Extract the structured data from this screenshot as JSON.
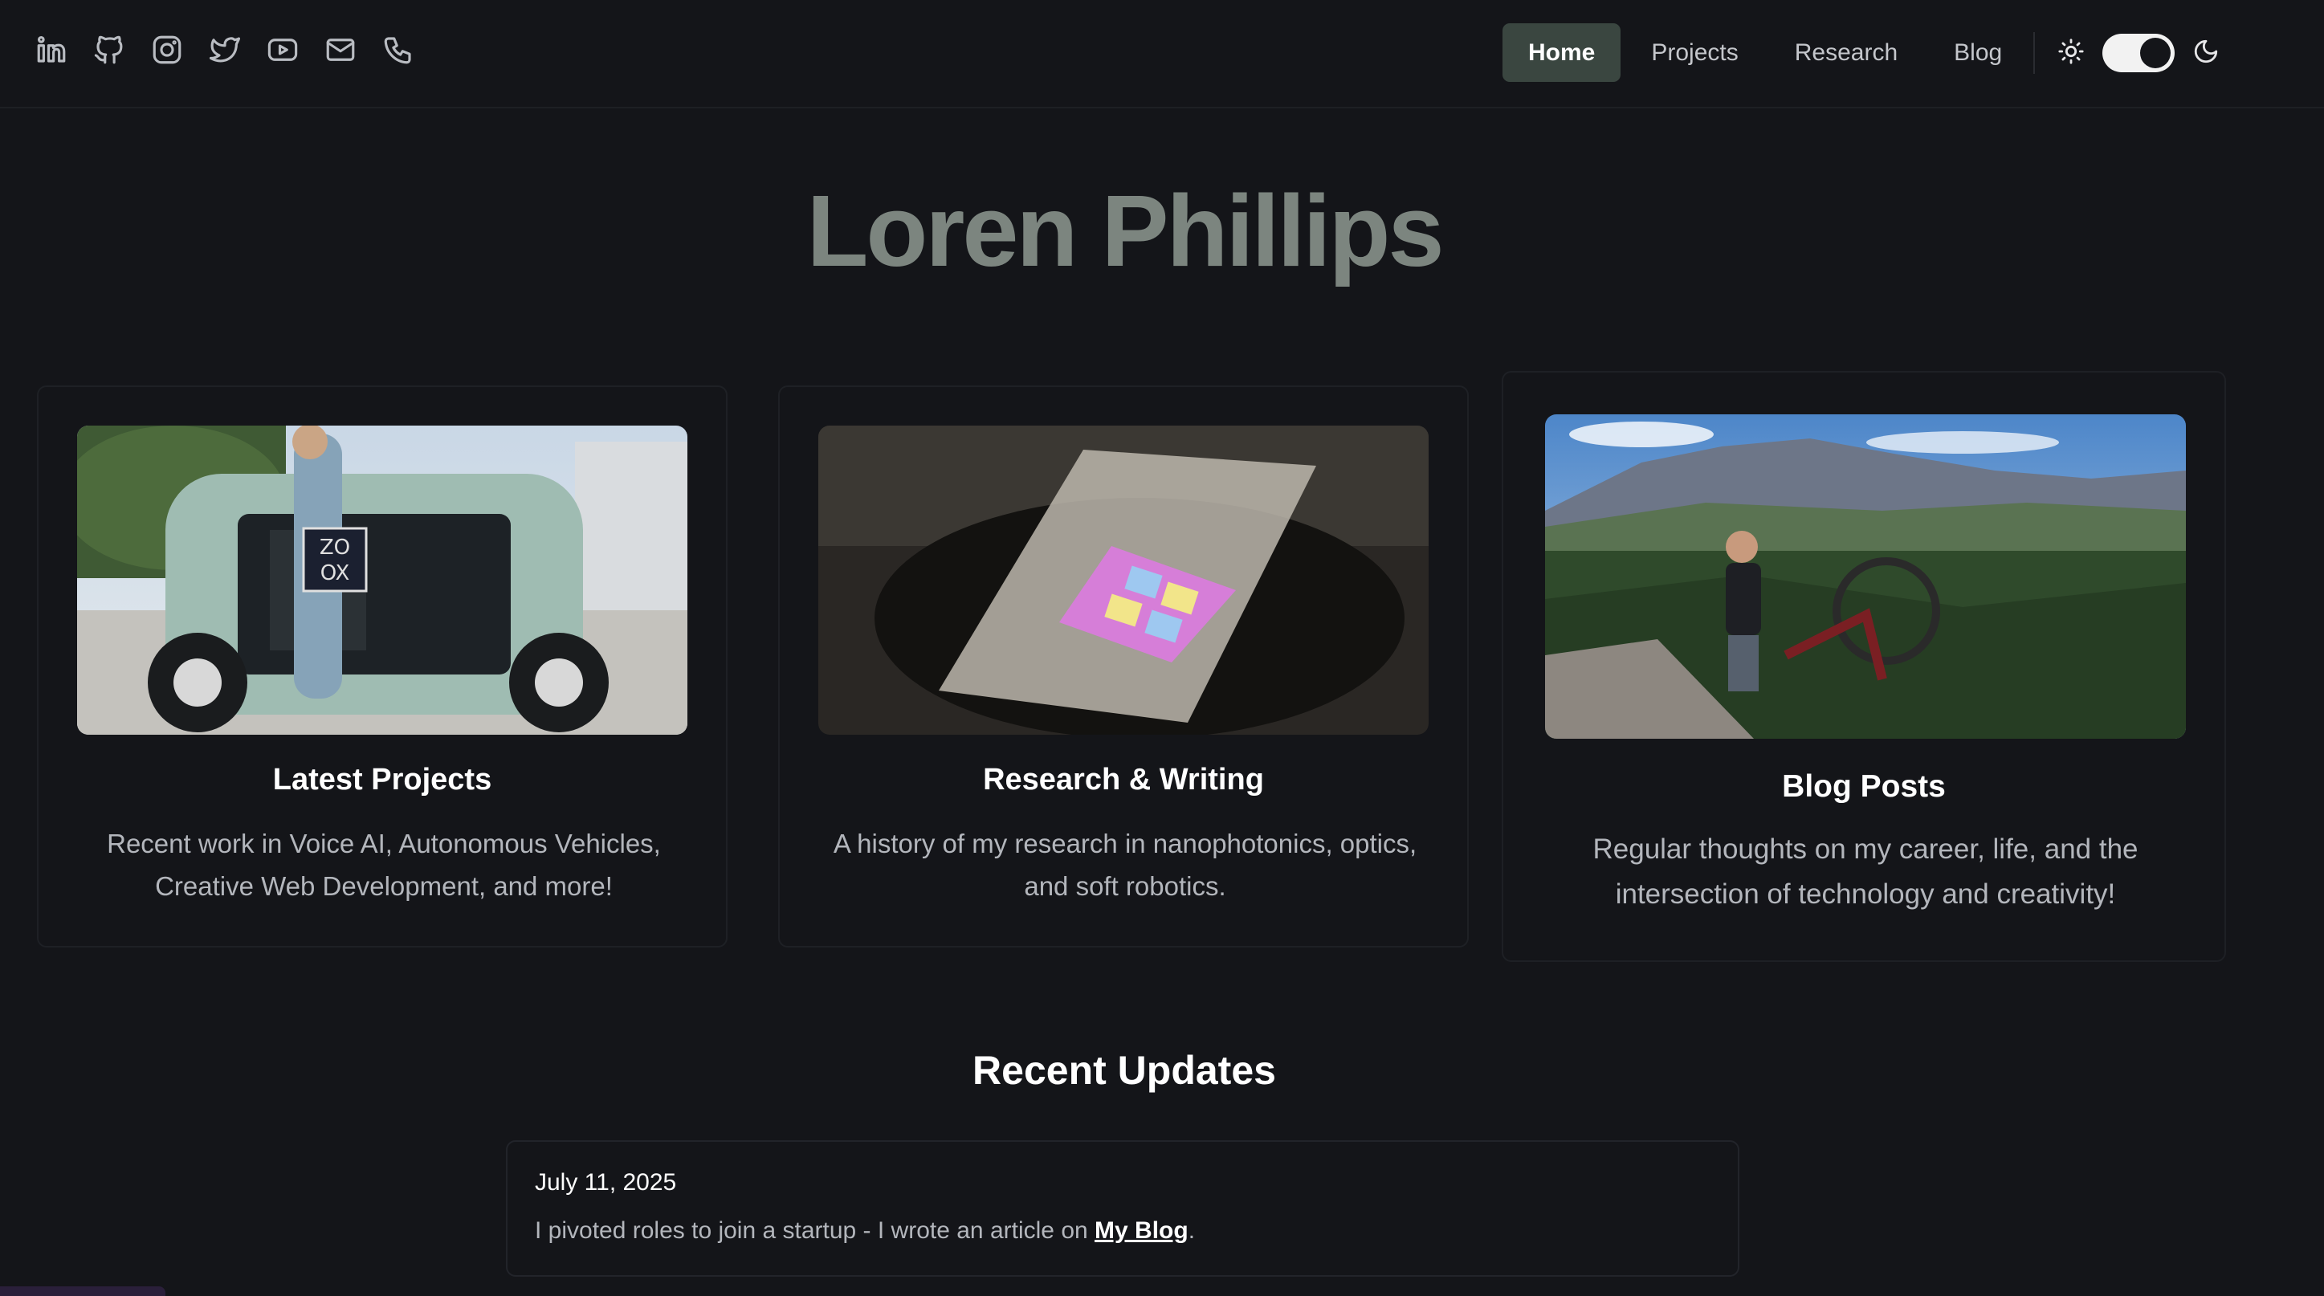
{
  "header": {
    "social_icons": [
      "linkedin-icon",
      "github-icon",
      "instagram-icon",
      "twitter-icon",
      "youtube-icon",
      "mail-icon",
      "phone-icon"
    ],
    "nav": [
      {
        "label": "Home",
        "active": true
      },
      {
        "label": "Projects",
        "active": false
      },
      {
        "label": "Research",
        "active": false
      },
      {
        "label": "Blog",
        "active": false
      }
    ],
    "theme_toggle": {
      "left_icon": "sun-icon",
      "right_icon": "moon-icon",
      "state": "dark"
    }
  },
  "hero": {
    "title": "Loren Phillips"
  },
  "cards": [
    {
      "title": "Latest Projects",
      "description": "Recent work in Voice AI, Autonomous Vehicles, Creative Web Development, and more!"
    },
    {
      "title": "Research & Writing",
      "description": "A history of my research in nanophotonics, optics, and soft robotics."
    },
    {
      "title": "Blog Posts",
      "description": "Regular thoughts on my career, life, and the intersection of technology and creativity!"
    }
  ],
  "updates": {
    "heading": "Recent Updates",
    "items": [
      {
        "date": "July 11, 2025",
        "text": "I pivoted roles to join a startup - I wrote an article on ",
        "link_label": "My Blog",
        "suffix": "."
      }
    ]
  },
  "colors": {
    "background": "#141519",
    "nav_active": "#3a4640",
    "title": "#7c857f"
  }
}
